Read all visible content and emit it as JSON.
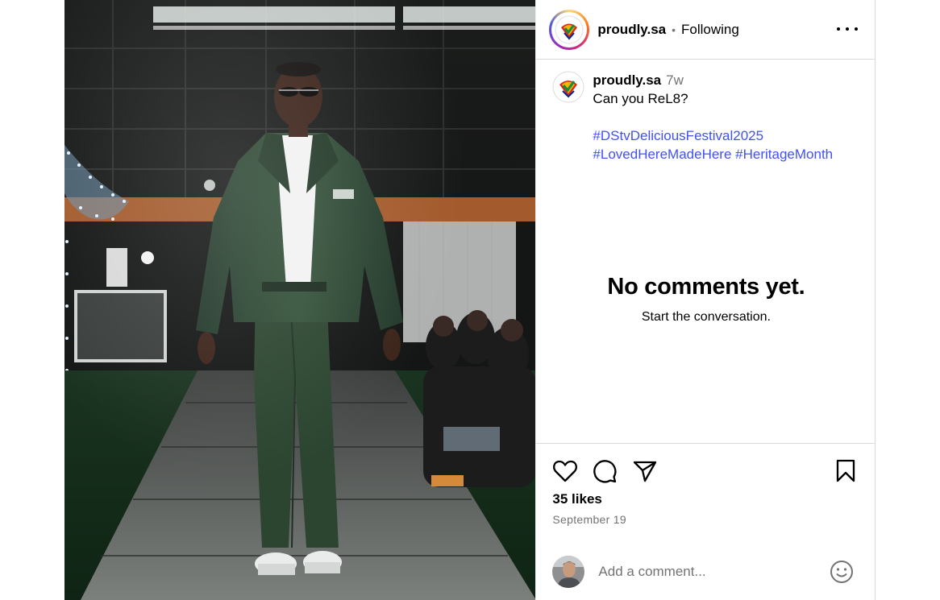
{
  "post": {
    "image_alt": "Model in dark green jacket and trousers walking a runway",
    "jacket_logo": "RE-L8"
  },
  "header": {
    "username": "proudly.sa",
    "separator": "•",
    "follow_status": "Following",
    "more_icon": "more-horizontal-icon"
  },
  "caption": {
    "username": "proudly.sa",
    "time_ago": "7w",
    "text": "Can you ReL8?",
    "hashtags": [
      "#DStvDeliciousFestival2025",
      "#LovedHereMadeHere",
      "#HeritageMonth"
    ]
  },
  "comments": {
    "empty_title": "No comments yet.",
    "empty_subtitle": "Start the conversation."
  },
  "actions": {
    "icons": [
      "heart-icon",
      "comment-icon",
      "share-icon",
      "bookmark-icon"
    ],
    "likes": "35 likes",
    "date": "September 19"
  },
  "comment_box": {
    "placeholder": "Add a comment...",
    "emoji_icon": "emoji-icon"
  },
  "colors": {
    "hashtag": "#4150f7",
    "border": "#dbdbdb",
    "muted": "#737373",
    "jacket": "#2d4a2f"
  }
}
